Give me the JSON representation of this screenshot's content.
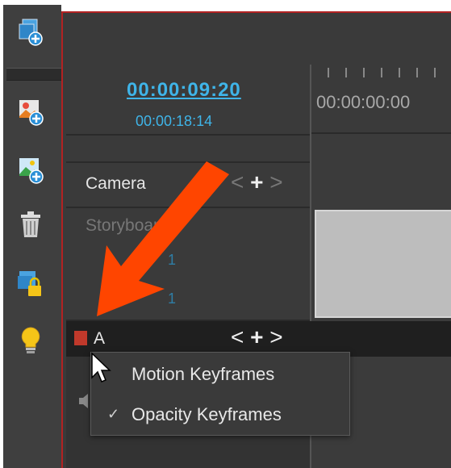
{
  "timecode": {
    "current": "00:00:09:20",
    "total": "00:00:18:14",
    "ruler_start": "00:00:00:00"
  },
  "tracks": {
    "camera_label": "Camera",
    "storyboard_label": "Storyboard",
    "dim_value_1": "1",
    "dim_value_2": "1",
    "track_a_label": "A"
  },
  "nav": {
    "prev": "<",
    "add": "+",
    "next": ">"
  },
  "context_menu": {
    "items": [
      {
        "label": "Motion Keyframes",
        "checked": false
      },
      {
        "label": "Opacity Keyframes",
        "checked": true
      }
    ],
    "check_glyph": "✓"
  },
  "colors": {
    "accent": "#3fb4e8",
    "arrow": "#ff4500",
    "frame_border": "#b22222"
  }
}
